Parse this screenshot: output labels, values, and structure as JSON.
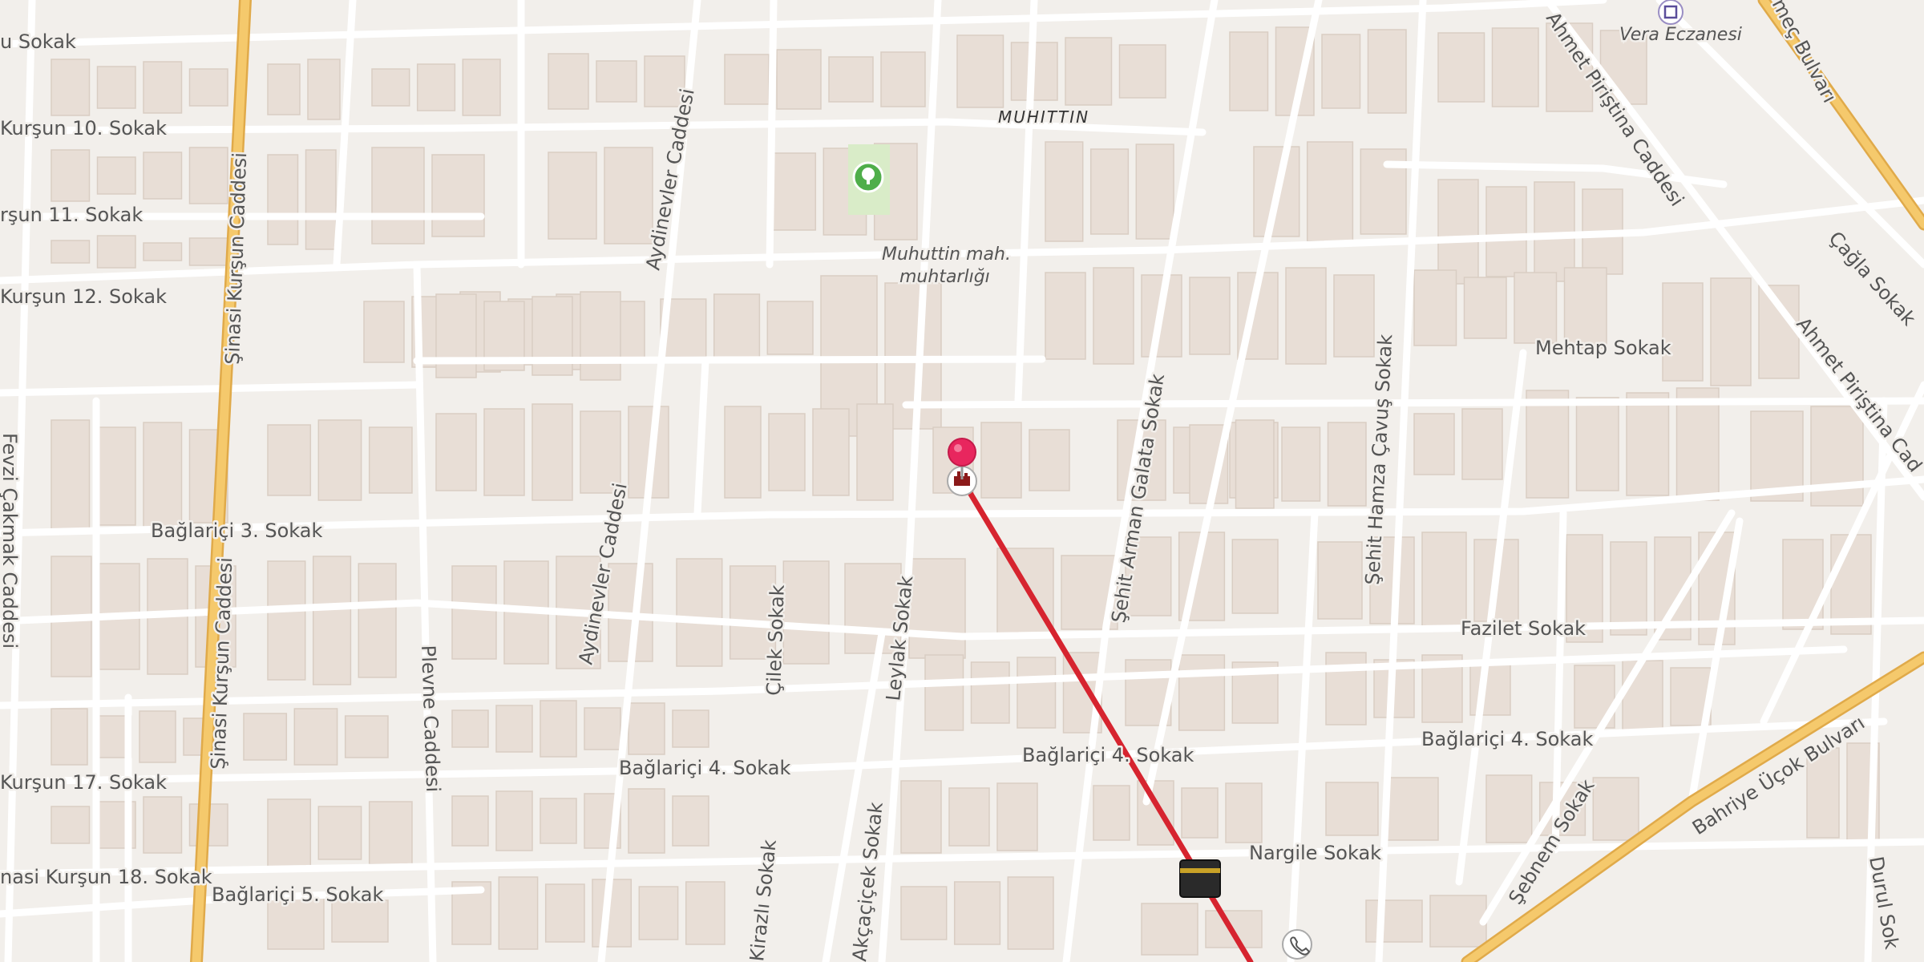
{
  "map": {
    "type": "street-map",
    "district": "MUHITTIN",
    "route_color": "#d6242f",
    "pin_color": "#e8265e",
    "streets": [
      {
        "id": "s1",
        "name": "u Sokak"
      },
      {
        "id": "s2",
        "name": "Kurşun 10. Sokak"
      },
      {
        "id": "s3",
        "name": "rşun 11. Sokak"
      },
      {
        "id": "s4",
        "name": "Kurşun 12. Sokak"
      },
      {
        "id": "s5",
        "name": "Şinasi Kurşun Caddesi"
      },
      {
        "id": "s6",
        "name": "Şinasi Kurşun Caddesi"
      },
      {
        "id": "s7",
        "name": "Aydinevler Caddesi"
      },
      {
        "id": "s8",
        "name": "Aydinevler Caddesi"
      },
      {
        "id": "s9",
        "name": "Bağlariçi 3. Sokak"
      },
      {
        "id": "s10",
        "name": "Fevzi Çakmak Caddesi"
      },
      {
        "id": "s11",
        "name": "Plevne Caddesi"
      },
      {
        "id": "s12",
        "name": "Çilek Sokak"
      },
      {
        "id": "s13",
        "name": "Leylak Sokak"
      },
      {
        "id": "s14",
        "name": "Şehit Arman Galata Sokak"
      },
      {
        "id": "s15",
        "name": "Şehit Hamza Çavuş Sokak"
      },
      {
        "id": "s16",
        "name": "Mehtap Sokak"
      },
      {
        "id": "s17",
        "name": "Fazilet Sokak"
      },
      {
        "id": "s18",
        "name": "Bağlariçi 4. Sokak"
      },
      {
        "id": "s19",
        "name": "Bağlariçi 4. Sokak"
      },
      {
        "id": "s20",
        "name": "Bağlariçi 4. Sokak"
      },
      {
        "id": "s21",
        "name": "Kurşun 17. Sokak"
      },
      {
        "id": "s22",
        "name": "nasi Kurşun 18. Sokak"
      },
      {
        "id": "s23",
        "name": "Bağlariçi 5. Sokak"
      },
      {
        "id": "s24",
        "name": "Kirazlı Sokak"
      },
      {
        "id": "s25",
        "name": "Akçaçiçek Sokak"
      },
      {
        "id": "s26",
        "name": "Nargile Sokak"
      },
      {
        "id": "s27",
        "name": "Şebnem Sokak"
      },
      {
        "id": "s28",
        "name": "Bahriye Üçok Bulvarı"
      },
      {
        "id": "s29",
        "name": "Durul Sok"
      },
      {
        "id": "s30",
        "name": "Ahmet Piriştina Caddesi"
      },
      {
        "id": "s31",
        "name": "Ahmet Piriştina Cad"
      },
      {
        "id": "s32",
        "name": "Çağla Sokak"
      },
      {
        "id": "s33",
        "name": "meç Bulvarı"
      }
    ],
    "pois": [
      {
        "id": "pharmacy",
        "name": "Vera Eczanesi",
        "icon": "pharmacy-icon"
      },
      {
        "id": "muhtar",
        "name_line1": "Muhuttin mah.",
        "name_line2": "muhtarlığı"
      },
      {
        "id": "park",
        "icon": "tree-icon"
      },
      {
        "id": "origin",
        "icon": "museum-icon"
      },
      {
        "id": "destination",
        "icon": "kaaba-icon"
      },
      {
        "id": "phone",
        "icon": "phone-icon"
      }
    ]
  }
}
